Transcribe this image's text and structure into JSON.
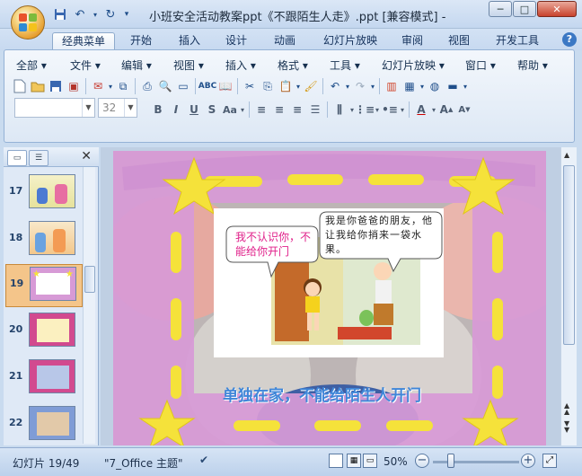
{
  "window": {
    "title": "小班安全活动教案ppt《不跟陌生人走》.ppt [兼容模式] - Micr...",
    "minimize_label": "─",
    "maximize_label": "□",
    "close_label": "✕"
  },
  "ribbon_tabs": [
    "经典菜单",
    "开始",
    "插入",
    "设计",
    "动画",
    "幻灯片放映",
    "审阅",
    "视图",
    "开发工具"
  ],
  "menus": [
    "全部",
    "文件",
    "编辑",
    "视图",
    "插入",
    "格式",
    "工具",
    "幻灯片放映",
    "窗口",
    "帮助"
  ],
  "format": {
    "font_name": "",
    "font_size": "32"
  },
  "slides_panel": {
    "items": [
      {
        "num": "17"
      },
      {
        "num": "18"
      },
      {
        "num": "19"
      },
      {
        "num": "20"
      },
      {
        "num": "21"
      },
      {
        "num": "22"
      }
    ],
    "selected": "19"
  },
  "slide": {
    "bubble_left": "我不认识你，不能给你开门",
    "bubble_right": "我是你爸爸的朋友，他让我给你捎来一袋水果。",
    "caption": "单独在家，不能给陌生人开门"
  },
  "status": {
    "slide_info": "幻灯片 19/49",
    "theme": "\"7_Office 主题\"",
    "zoom": "50%"
  },
  "colors": {
    "accent": "#1f4e8a",
    "frame_pink": "#d79ad6",
    "star_yellow": "#f5e23a",
    "caption_blue": "#3f86d8",
    "bubble_text_pink": "#e0208a"
  }
}
